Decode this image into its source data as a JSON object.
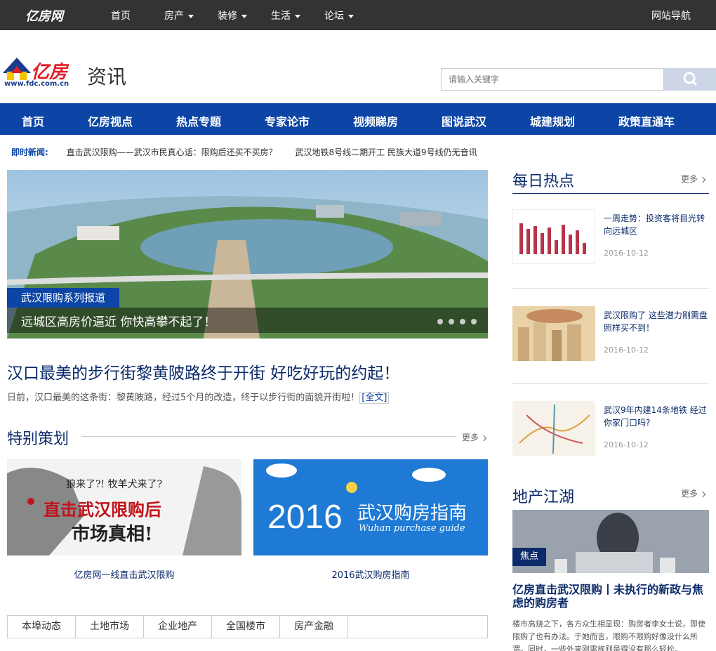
{
  "topbar": {
    "brand": "亿房网",
    "items": [
      {
        "label": "首页",
        "dropdown": false
      },
      {
        "label": "房产",
        "dropdown": true
      },
      {
        "label": "装修",
        "dropdown": true
      },
      {
        "label": "生活",
        "dropdown": true
      },
      {
        "label": "论坛",
        "dropdown": true
      }
    ],
    "site_nav": "网站导航"
  },
  "header": {
    "logo_text": "亿房",
    "logo_url": "www.fdc.com.cn",
    "section_title": "资讯",
    "search_placeholder": "请输入关键字"
  },
  "mainnav": [
    "首页",
    "亿房视点",
    "热点专题",
    "专家论市",
    "视频睇房",
    "图说武汉",
    "城建规划",
    "政策直通车"
  ],
  "ticker": {
    "label": "即时新闻:",
    "items": [
      "直击武汉限购——武汉市民真心话：限购后还买不买房？",
      "武汉地铁8号线二期开工 民族大道9号线仍无音讯"
    ]
  },
  "banner": {
    "tag": "武汉限购系列报道",
    "caption": "远城区高房价逼近 你快高攀不起了！",
    "dots": 4
  },
  "headline": {
    "title": "汉口最美的步行街黎黄陂路终于开街 好吃好玩的约起！",
    "summary": "日前，汉口最美的这条街：黎黄陂路，经过5个月的改造，终于以步行街的面貌开街啦！",
    "full_link": "[全文]"
  },
  "special": {
    "title": "特别策划",
    "more": "更多",
    "items": [
      {
        "caption": "亿房网一线直击武汉限购",
        "img_text_top": "狼来了?! 牧羊犬来了?",
        "img_text_main": "直击武汉限购后",
        "img_text_sub": "市场真相!"
      },
      {
        "caption": "2016武汉购房指南",
        "img_year": "2016",
        "img_title": "武汉购房指南",
        "img_sub": "Wuhan purchase guide"
      }
    ]
  },
  "tabs": [
    "本埠动态",
    "土地市场",
    "企业地产",
    "全国楼市",
    "房产金融"
  ],
  "hot": {
    "title": "每日热点",
    "more": "更多",
    "items": [
      {
        "title": "一周走势：投资客将目光转向远城区",
        "date": "2016-10-12"
      },
      {
        "title": "武汉限购了 这些潜力刚需盘照样买不到！",
        "date": "2016-10-12"
      },
      {
        "title": "武汉9年内建14条地铁 经过你家门口吗?",
        "date": "2016-10-12"
      }
    ]
  },
  "jianghu": {
    "title": "地产江湖",
    "more": "更多",
    "focus_tag": "焦点",
    "headline": "亿房直击武汉限购丨未执行的新政与焦虑的购房者",
    "text": "楼市高烧之下，各方众生相显现：购房者李女士说，即使限购了也有办法。于她而言，限购不限购好像没什么所谓。同时，一些外来刚需族则是得没有那么轻松。"
  },
  "colors": {
    "nav_blue": "#0c45a6",
    "dark_title": "#0c2b6b",
    "topbar": "#333333",
    "logo_red": "#e31b23"
  }
}
